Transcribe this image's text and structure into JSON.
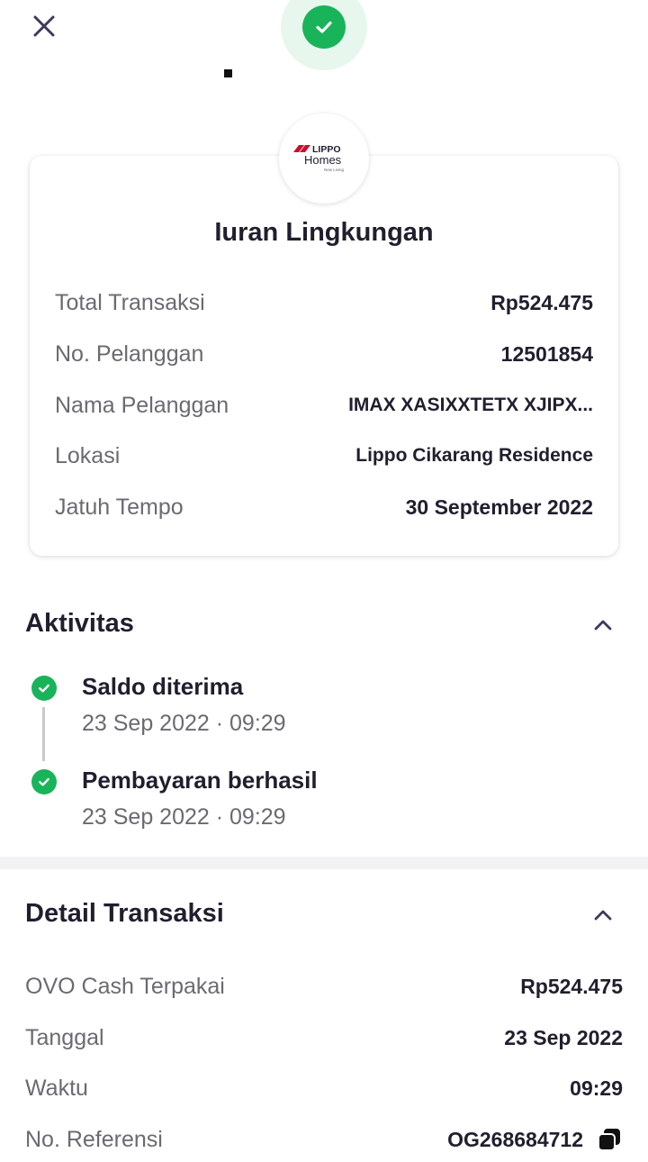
{
  "header": {
    "close_icon": "close-icon",
    "status_icon": "check-icon",
    "accent": "#19b35a"
  },
  "biller": {
    "logo_line1": "LIPPO",
    "logo_line2": "Homes",
    "logo_tagline": "New Living",
    "logo_color": "#c8102e",
    "title": "Iuran Lingkungan",
    "rows": [
      {
        "label": "Total Transaksi",
        "value": "Rp524.475"
      },
      {
        "label": "No. Pelanggan",
        "value": "12501854"
      },
      {
        "label": "Nama Pelanggan",
        "value": "IMAX XASIXXTETX XJIPX..."
      },
      {
        "label": "Lokasi",
        "value": "Lippo Cikarang Residence"
      },
      {
        "label": "Jatuh Tempo",
        "value": "30 September 2022"
      }
    ]
  },
  "activity": {
    "title": "Aktivitas",
    "chevron_icon": "chevron-up-icon",
    "events": [
      {
        "title": "Saldo diterima",
        "time": "23 Sep 2022 · 09:29"
      },
      {
        "title": "Pembayaran berhasil",
        "time": "23 Sep 2022 · 09:29"
      }
    ]
  },
  "details": {
    "title": "Detail Transaksi",
    "chevron_icon": "chevron-up-icon",
    "rows": [
      {
        "label": "OVO Cash Terpakai",
        "value": "Rp524.475"
      },
      {
        "label": "Tanggal",
        "value": "23 Sep 2022"
      },
      {
        "label": "Waktu",
        "value": "09:29"
      },
      {
        "label": "No. Referensi",
        "value": "OG268684712"
      }
    ],
    "copy_icon": "copy-icon"
  }
}
